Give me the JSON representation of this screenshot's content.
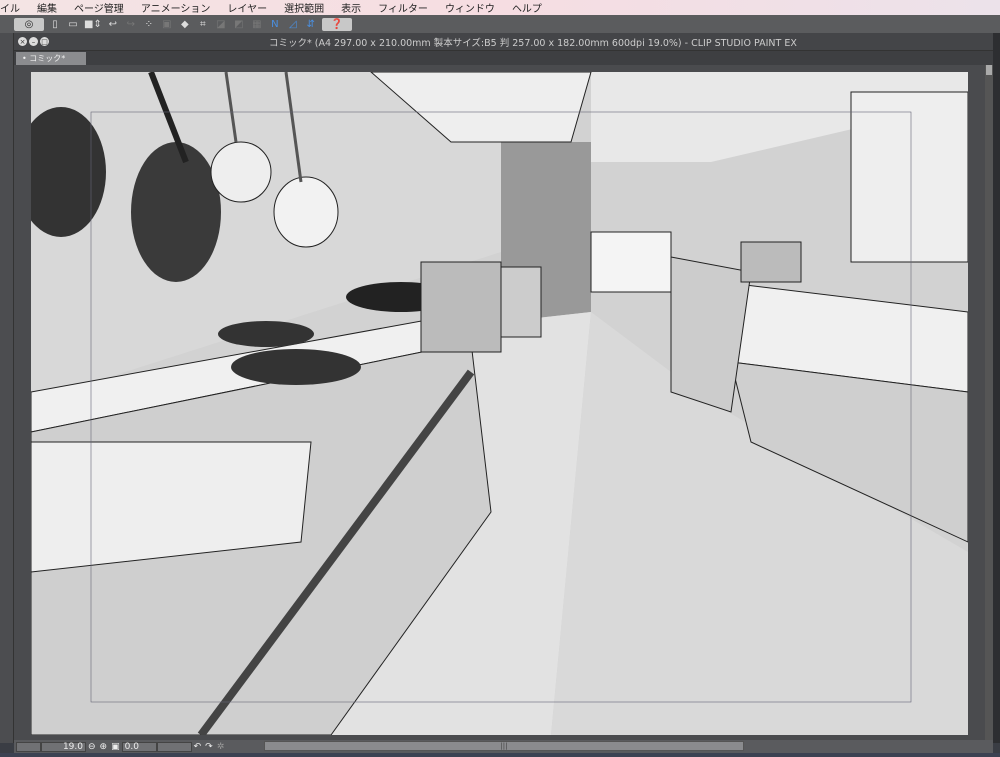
{
  "menu": [
    "イル",
    "編集",
    "ページ管理",
    "アニメーション",
    "レイヤー",
    "選択範囲",
    "表示",
    "フィルター",
    "ウィンドウ",
    "ヘルプ"
  ],
  "toolbar": {
    "icons": [
      "clip-studio-logo-icon",
      "new-file-icon",
      "open-file-icon",
      "save-icon",
      "undo-icon",
      "redo-icon",
      "transform-icon",
      "select-icon",
      "fill-icon",
      "crop-icon",
      "ruler-off-icon",
      "ruler-icon",
      "grid-icon",
      "snap-ruler-icon",
      "snap-special-icon",
      "snap-grid-icon",
      "help-icon"
    ]
  },
  "window": {
    "title": "コミック* (A4 297.00 x 210.00mm 製本サイズ:B5 判 257.00 x 182.00mm 600dpi 19.0%)  - CLIP STUDIO PAINT EX",
    "tab": "コミック*"
  },
  "status": {
    "zoom": "19.0",
    "angle": "0.0"
  }
}
